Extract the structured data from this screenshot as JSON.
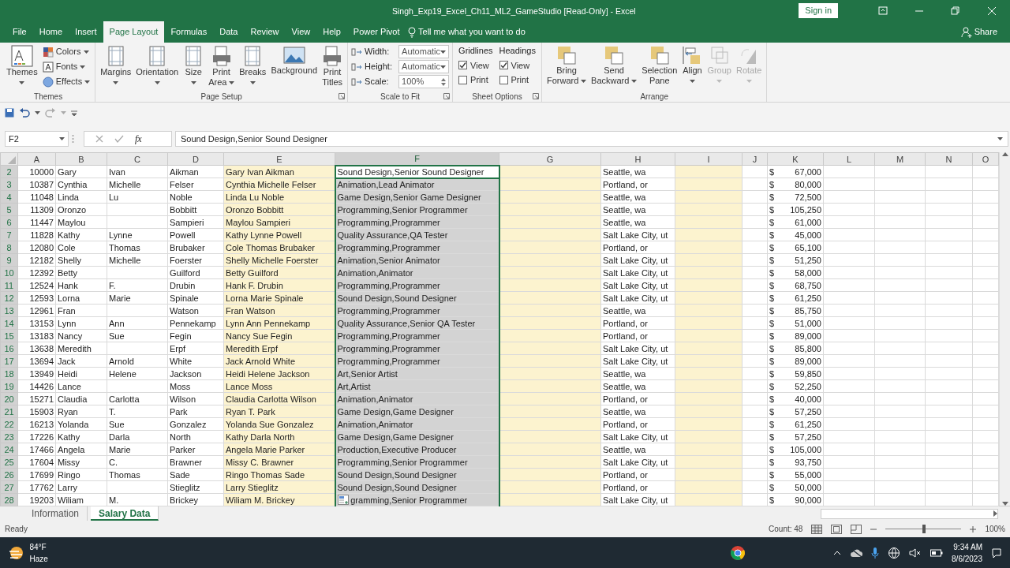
{
  "window": {
    "title": "Singh_Exp19_Excel_Ch11_ML2_GameStudio  [Read-Only]  -  Excel",
    "sign_in": "Sign in"
  },
  "tabs": [
    {
      "label": "File",
      "selected": false
    },
    {
      "label": "Home",
      "selected": false
    },
    {
      "label": "Insert",
      "selected": false
    },
    {
      "label": "Page Layout",
      "selected": true
    },
    {
      "label": "Formulas",
      "selected": false
    },
    {
      "label": "Data",
      "selected": false
    },
    {
      "label": "Review",
      "selected": false
    },
    {
      "label": "View",
      "selected": false
    },
    {
      "label": "Help",
      "selected": false
    },
    {
      "label": "Power Pivot",
      "selected": false
    }
  ],
  "tell_me": "Tell me what you want to do",
  "share": "Share",
  "ribbon": {
    "groups": [
      {
        "label": "Themes",
        "launcher": false,
        "items": [
          {
            "kind": "large",
            "label": [
              "Themes"
            ],
            "dropdown": true
          },
          {
            "kind": "small",
            "label": "Colors",
            "dropdown": true
          },
          {
            "kind": "small",
            "label": "Fonts",
            "dropdown": true
          },
          {
            "kind": "small",
            "label": "Effects",
            "dropdown": true
          }
        ]
      },
      {
        "label": "Page Setup",
        "launcher": true,
        "items": [
          {
            "kind": "large",
            "label": [
              "Margins"
            ],
            "dropdown": true
          },
          {
            "kind": "large",
            "label": [
              "Orientation"
            ],
            "dropdown": true
          },
          {
            "kind": "large",
            "label": [
              "Size"
            ],
            "dropdown": true
          },
          {
            "kind": "large",
            "label": [
              "Print",
              "Area"
            ],
            "dropdown": true
          },
          {
            "kind": "large",
            "label": [
              "Breaks"
            ],
            "dropdown": true
          },
          {
            "kind": "large",
            "label": [
              "Background"
            ],
            "dropdown": false
          },
          {
            "kind": "large",
            "label": [
              "Print",
              "Titles"
            ],
            "dropdown": false
          }
        ]
      },
      {
        "label": "Scale to Fit",
        "launcher": true,
        "items": [
          {
            "kind": "field",
            "label": "Width:",
            "value": "Automatic",
            "dropdown": true,
            "spinner": false
          },
          {
            "kind": "field",
            "label": "Height:",
            "value": "Automatic",
            "dropdown": true,
            "spinner": false
          },
          {
            "kind": "field",
            "label": "Scale:",
            "value": "100%",
            "dropdown": false,
            "spinner": true
          }
        ]
      },
      {
        "label": "Sheet Options",
        "launcher": true,
        "items": [
          {
            "kind": "checks",
            "label": "Gridlines",
            "options": [
              {
                "label": "View",
                "checked": true
              },
              {
                "label": "Print",
                "checked": false
              }
            ]
          },
          {
            "kind": "checks",
            "label": "Headings",
            "options": [
              {
                "label": "View",
                "checked": true
              },
              {
                "label": "Print",
                "checked": false
              }
            ]
          }
        ]
      },
      {
        "label": "Arrange",
        "launcher": false,
        "items": [
          {
            "kind": "large",
            "label": [
              "Bring",
              "Forward"
            ],
            "dropdown": true,
            "disabled": false
          },
          {
            "kind": "large",
            "label": [
              "Send",
              "Backward"
            ],
            "dropdown": true,
            "disabled": false
          },
          {
            "kind": "large",
            "label": [
              "Selection",
              "Pane"
            ],
            "dropdown": false,
            "disabled": false
          },
          {
            "kind": "large",
            "label": [
              "Align"
            ],
            "dropdown": true,
            "disabled": false
          },
          {
            "kind": "large",
            "label": [
              "Group"
            ],
            "dropdown": true,
            "disabled": true
          },
          {
            "kind": "large",
            "label": [
              "Rotate"
            ],
            "dropdown": true,
            "disabled": true
          }
        ]
      }
    ]
  },
  "formula_bar": {
    "name_box": "F2",
    "fx": "fx",
    "formula": "Sound Design,Senior Sound Designer"
  },
  "columns": [
    {
      "letter": "A",
      "selected": false
    },
    {
      "letter": "B",
      "selected": false
    },
    {
      "letter": "C",
      "selected": false
    },
    {
      "letter": "D",
      "selected": false
    },
    {
      "letter": "E",
      "selected": false
    },
    {
      "letter": "F",
      "selected": true
    },
    {
      "letter": "G",
      "selected": false
    },
    {
      "letter": "H",
      "selected": false
    },
    {
      "letter": "I",
      "selected": false
    },
    {
      "letter": "J",
      "selected": false
    },
    {
      "letter": "K",
      "selected": false
    },
    {
      "letter": "L",
      "selected": false
    },
    {
      "letter": "M",
      "selected": false
    },
    {
      "letter": "N",
      "selected": false
    },
    {
      "letter": "O",
      "selected": false
    }
  ],
  "rows": [
    {
      "number": "2",
      "selected": true,
      "active": true,
      "id": "10000",
      "first": "Gary",
      "middle": "Ivan",
      "last": "Aikman",
      "full": "Gary Ivan Aikman",
      "role": "Sound Design,Senior Sound Designer",
      "city": "Seattle, wa",
      "currency": "$",
      "salary": "67,000"
    },
    {
      "number": "3",
      "selected": true,
      "active": false,
      "id": "10387",
      "first": "Cynthia",
      "middle": "Michelle",
      "last": "Felser",
      "full": "Cynthia Michelle Felser",
      "role": "Animation,Lead Animator",
      "city": "Portland, or",
      "currency": "$",
      "salary": "80,000"
    },
    {
      "number": "4",
      "selected": true,
      "active": false,
      "id": "11048",
      "first": "Linda",
      "middle": "Lu",
      "last": "Noble",
      "full": "Linda Lu Noble",
      "role": "Game Design,Senior Game Designer",
      "city": "Seattle, wa",
      "currency": "$",
      "salary": "72,500"
    },
    {
      "number": "5",
      "selected": true,
      "active": false,
      "id": "11309",
      "first": "Oronzo",
      "last": "Bobbitt",
      "full": "Oronzo Bobbitt",
      "role": "Programming,Senior Programmer",
      "city": "Seattle, wa",
      "currency": "$",
      "salary": "105,250"
    },
    {
      "number": "6",
      "selected": true,
      "active": false,
      "id": "11447",
      "first": "Maylou",
      "last": "Sampieri",
      "full": "Maylou Sampieri",
      "role": "Programming,Programmer",
      "city": "Seattle, wa",
      "currency": "$",
      "salary": "61,000"
    },
    {
      "number": "7",
      "selected": true,
      "active": false,
      "id": "11828",
      "first": "Kathy",
      "middle": "Lynne",
      "last": "Powell",
      "full": "Kathy Lynne Powell",
      "role": "Quality Assurance,QA Tester",
      "city": "Salt Lake City, ut",
      "currency": "$",
      "salary": "45,000"
    },
    {
      "number": "8",
      "selected": true,
      "active": false,
      "id": "12080",
      "first": "Cole",
      "middle": "Thomas",
      "last": "Brubaker",
      "full": "Cole Thomas Brubaker",
      "role": "Programming,Programmer",
      "city": "Portland, or",
      "currency": "$",
      "salary": "65,100"
    },
    {
      "number": "9",
      "selected": true,
      "active": false,
      "id": "12182",
      "first": "Shelly",
      "middle": "Michelle",
      "last": "Foerster",
      "full": "Shelly Michelle Foerster",
      "role": "Animation,Senior Animator",
      "city": "Salt Lake City, ut",
      "currency": "$",
      "salary": "51,250"
    },
    {
      "number": "10",
      "selected": true,
      "active": false,
      "id": "12392",
      "first": "Betty",
      "last": "Guilford",
      "full": "Betty Guilford",
      "role": "Animation,Animator",
      "city": "Salt Lake City, ut",
      "currency": "$",
      "salary": "58,000"
    },
    {
      "number": "11",
      "selected": true,
      "active": false,
      "id": "12524",
      "first": "Hank",
      "middle": "F.",
      "last": "Drubin",
      "full": "Hank F. Drubin",
      "role": "Programming,Programmer",
      "city": "Salt Lake City, ut",
      "currency": "$",
      "salary": "68,750"
    },
    {
      "number": "12",
      "selected": true,
      "active": false,
      "id": "12593",
      "first": "Lorna",
      "middle": "Marie",
      "last": "Spinale",
      "full": "Lorna Marie Spinale",
      "role": "Sound Design,Sound Designer",
      "city": "Salt Lake City, ut",
      "currency": "$",
      "salary": "61,250"
    },
    {
      "number": "13",
      "selected": true,
      "active": false,
      "id": "12961",
      "first": "Fran",
      "last": "Watson",
      "full": "Fran Watson",
      "role": "Programming,Programmer",
      "city": "Seattle, wa",
      "currency": "$",
      "salary": "85,750"
    },
    {
      "number": "14",
      "selected": true,
      "active": false,
      "id": "13153",
      "first": "Lynn",
      "middle": "Ann",
      "last": "Pennekamp",
      "full": "Lynn Ann Pennekamp",
      "role": "Quality Assurance,Senior QA Tester",
      "city": "Portland, or",
      "currency": "$",
      "salary": "51,000"
    },
    {
      "number": "15",
      "selected": true,
      "active": false,
      "id": "13183",
      "first": "Nancy",
      "middle": "Sue",
      "last": "Fegin",
      "full": "Nancy Sue Fegin",
      "role": "Programming,Programmer",
      "city": "Portland, or",
      "currency": "$",
      "salary": "89,000"
    },
    {
      "number": "16",
      "selected": true,
      "active": false,
      "id": "13638",
      "first": "Meredith",
      "last": "Erpf",
      "full": "Meredith Erpf",
      "role": "Programming,Programmer",
      "city": "Salt Lake City, ut",
      "currency": "$",
      "salary": "85,800"
    },
    {
      "number": "17",
      "selected": true,
      "active": false,
      "id": "13694",
      "first": "Jack",
      "middle": "Arnold",
      "last": "White",
      "full": "Jack Arnold White",
      "role": "Programming,Programmer",
      "city": "Salt Lake City, ut",
      "currency": "$",
      "salary": "89,000"
    },
    {
      "number": "18",
      "selected": true,
      "active": false,
      "id": "13949",
      "first": "Heidi",
      "middle": "Helene",
      "last": "Jackson",
      "full": "Heidi Helene Jackson",
      "role": "Art,Senior Artist",
      "city": "Seattle, wa",
      "currency": "$",
      "salary": "59,850"
    },
    {
      "number": "19",
      "selected": true,
      "active": false,
      "id": "14426",
      "first": "Lance",
      "last": "Moss",
      "full": "Lance Moss",
      "role": "Art,Artist",
      "city": "Seattle, wa",
      "currency": "$",
      "salary": "52,250"
    },
    {
      "number": "20",
      "selected": true,
      "active": false,
      "id": "15271",
      "first": "Claudia",
      "middle": "Carlotta",
      "last": "Wilson",
      "full": "Claudia Carlotta Wilson",
      "role": "Animation,Animator",
      "city": "Portland, or",
      "currency": "$",
      "salary": "40,000"
    },
    {
      "number": "21",
      "selected": true,
      "active": false,
      "id": "15903",
      "first": "Ryan",
      "middle": "T.",
      "last": "Park",
      "full": "Ryan T. Park",
      "role": "Game Design,Game Designer",
      "city": "Seattle, wa",
      "currency": "$",
      "salary": "57,250"
    },
    {
      "number": "22",
      "selected": true,
      "active": false,
      "id": "16213",
      "first": "Yolanda",
      "middle": "Sue",
      "last": "Gonzalez",
      "full": "Yolanda Sue Gonzalez",
      "role": "Animation,Animator",
      "city": "Portland, or",
      "currency": "$",
      "salary": "61,250"
    },
    {
      "number": "23",
      "selected": true,
      "active": false,
      "id": "17226",
      "first": "Kathy",
      "middle": "Darla",
      "last": "North",
      "full": "Kathy Darla North",
      "role": "Game Design,Game Designer",
      "city": "Salt Lake City, ut",
      "currency": "$",
      "salary": "57,250"
    },
    {
      "number": "24",
      "selected": true,
      "active": false,
      "id": "17466",
      "first": "Angela",
      "middle": "Marie",
      "last": "Parker",
      "full": "Angela Marie Parker",
      "role": "Production,Executive Producer",
      "city": "Seattle, wa",
      "currency": "$",
      "salary": "105,000"
    },
    {
      "number": "25",
      "selected": true,
      "active": false,
      "id": "17604",
      "first": "Missy",
      "middle": "C.",
      "last": "Brawner",
      "full": "Missy C. Brawner",
      "role": "Programming,Senior Programmer",
      "city": "Salt Lake City, ut",
      "currency": "$",
      "salary": "93,750"
    },
    {
      "number": "26",
      "selected": true,
      "active": false,
      "id": "17699",
      "first": "Ringo",
      "middle": "Thomas",
      "last": "Sade",
      "full": "Ringo Thomas Sade",
      "role": "Sound Design,Sound Designer",
      "city": "Portland, or",
      "currency": "$",
      "salary": "55,000"
    },
    {
      "number": "27",
      "selected": true,
      "active": false,
      "id": "17762",
      "first": "Larry",
      "last": "Stieglitz",
      "full": "Larry Stieglitz",
      "role": "Sound Design,Sound Designer",
      "city": "Portland, or",
      "currency": "$",
      "salary": "50,000"
    },
    {
      "number": "28",
      "selected": true,
      "active": false,
      "id": "19203",
      "first": "Wiliam",
      "middle": "M.",
      "last": "Brickey",
      "full": "Wiliam M. Brickey",
      "role": "gramming,Senior Programmer",
      "city": "Salt Lake City, ut",
      "currency": "$",
      "salary": "90,000"
    }
  ],
  "sheet_tabs": [
    {
      "label": "Information",
      "selected": false
    },
    {
      "label": "Salary Data",
      "selected": true
    }
  ],
  "status_bar": {
    "mode": "Ready",
    "count": "Count: 48",
    "zoom": "100%",
    "zoom_level": {
      "level": 0.5
    }
  },
  "taskbar": {
    "temperature": "84°F",
    "weather": "Haze",
    "time": "9:34 AM",
    "date": "8/6/2023"
  }
}
